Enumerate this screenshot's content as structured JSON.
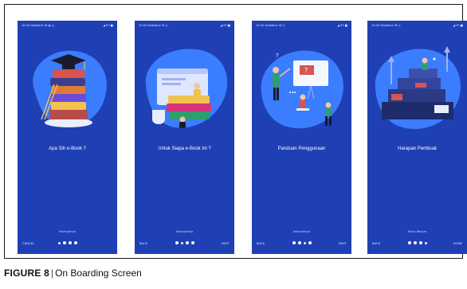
{
  "caption": {
    "label": "FIGURE 8",
    "separator": "|",
    "text": "On Boarding Screen"
  },
  "colors": {
    "screen_bg": "#1f3fb4",
    "blob": "#3b7dff",
    "text": "#ffffff"
  },
  "screens": [
    {
      "status_left": "10:40 Vodafone ID ◉ ◎",
      "status_right": "◢ 93 ■",
      "title": "Apa Sih e-Book ?",
      "description": "",
      "skip_label": "Selanjutnya",
      "left_label": "CANCEL",
      "right_label": "",
      "illustration": "stack-of-books-graduation-cap"
    },
    {
      "status_left": "10:40 Vodafone ID ◎",
      "status_right": "◢ 93 ■",
      "title": "Untuk Siapa e-Book Ini ?",
      "description": "",
      "skip_label": "Selanjutnya",
      "left_label": "BACK",
      "right_label": "NEXT",
      "illustration": "books-and-browser-reading-people"
    },
    {
      "status_left": "10:40 Vodafone ID ◎",
      "status_right": "◢ 93 ■",
      "title": "Panduan Penggunaan",
      "description": "",
      "skip_label": "Selanjutnya",
      "left_label": "BACK",
      "right_label": "NEXT",
      "illustration": "presentation-classroom"
    },
    {
      "status_left": "10:40 Vodafone ID ◎",
      "status_right": "◢ 93 ■",
      "title": "Harapan Pembuat",
      "description": "",
      "skip_label": "Mulai Belajar",
      "left_label": "BACK",
      "right_label": "DONE",
      "illustration": "stairs-of-books-growth"
    }
  ]
}
